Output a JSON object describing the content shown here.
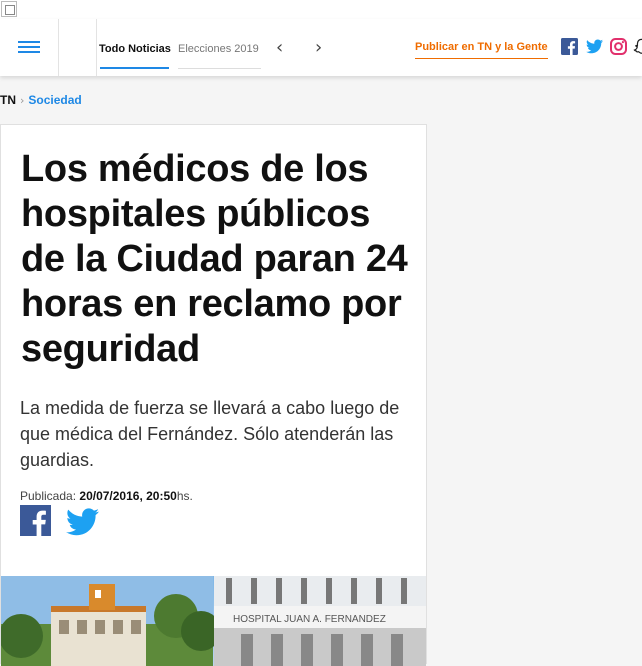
{
  "colors": {
    "accent": "#1e88e5",
    "publish": "#ef6c00",
    "facebook": "#3b5998",
    "twitter": "#1da1f2",
    "instagram": "#e1306c"
  },
  "header": {
    "menu_icon": "hamburger-menu-icon",
    "tabs": [
      {
        "label": "Todo Noticias",
        "active": true
      },
      {
        "label": "Elecciones 2019",
        "active": false
      }
    ],
    "prev_arrow": "‹",
    "next_arrow": "›",
    "publish_label": "Publicar en TN y la Gente",
    "social_icons": [
      "facebook-icon",
      "twitter-icon",
      "instagram-icon",
      "snapchat-icon"
    ]
  },
  "breadcrumb": {
    "root": "TN",
    "separator": "›",
    "section": "Sociedad"
  },
  "article": {
    "title": "Los médicos de los hospitales públicos de la Ciudad paran 24 horas en reclamo por seguridad",
    "lead": "La medida de fuerza se llevará a cabo luego de que médica del Fernández. Sólo atenderán las guardias.",
    "published_label": "Publicada:",
    "published_date": "20/07/2016, 20:50",
    "published_suffix": "hs.",
    "share_icons": [
      "facebook-share-icon",
      "twitter-share-icon"
    ]
  },
  "hero_image": {
    "sign_text": "HOSPITAL JUAN A. FERNANDEZ"
  }
}
